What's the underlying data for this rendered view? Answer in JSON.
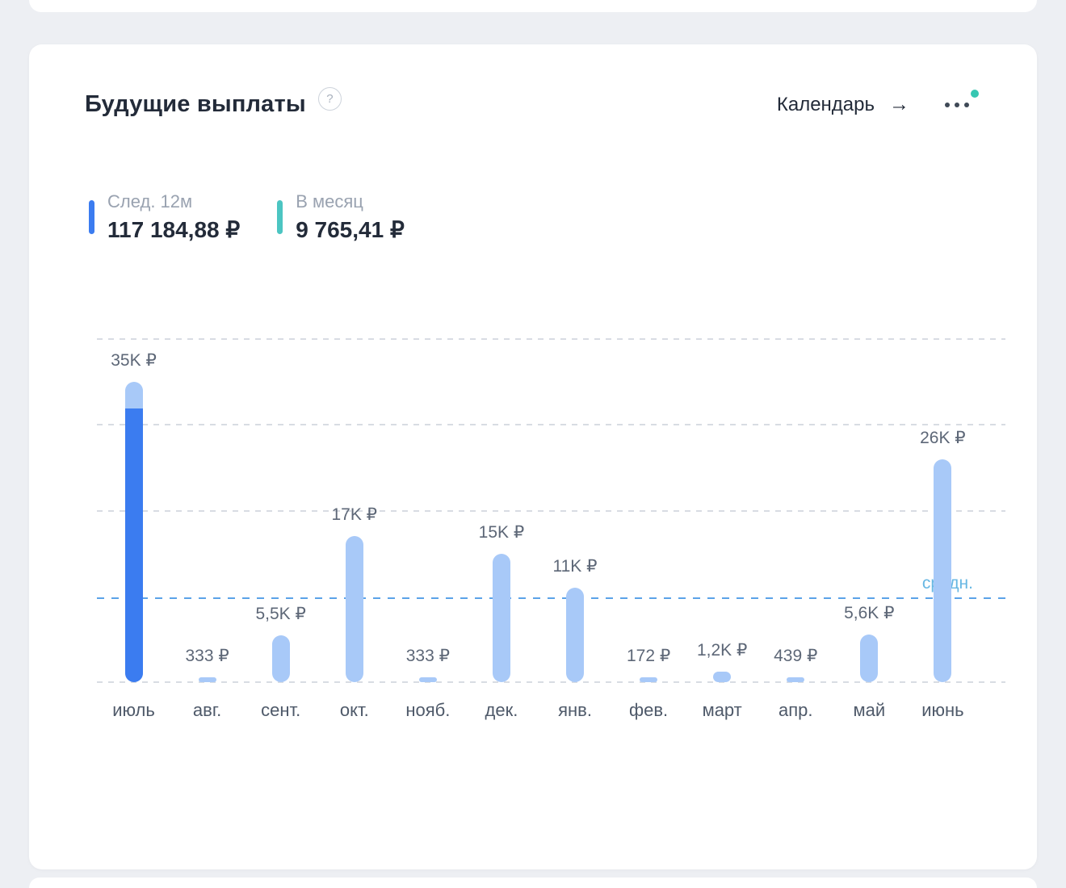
{
  "colors": {
    "background": "#edeff3",
    "card": "#ffffff",
    "title": "#232b39",
    "accent_blue": "#3b7cf0",
    "bar_light": "#a8c9f8",
    "accent_teal": "#4cc5c2",
    "muted_label": "#99a2b0",
    "value_label": "#5d6777",
    "month_label": "#4e5969",
    "grid": "#d8dce3",
    "avg_line": "#5ba3e8",
    "avg_label": "#67b7e3",
    "menu_dot": "#3f4956",
    "notification_dot": "#36c7b2",
    "help_icon": "#a8b0bc"
  },
  "header": {
    "title": "Будущие выплаты",
    "help_icon": "?",
    "calendar_label": "Календарь",
    "arrow_icon": "→"
  },
  "stats": [
    {
      "label": "След. 12м",
      "value": "117 184,88 ₽"
    },
    {
      "label": "В месяц",
      "value": "9 765,41 ₽"
    }
  ],
  "chart_data": {
    "type": "bar",
    "title": "",
    "xlabel": "",
    "ylabel": "",
    "categories": [
      "июль",
      "авг.",
      "сент.",
      "окт.",
      "нояб.",
      "дек.",
      "янв.",
      "фев.",
      "март",
      "апр.",
      "май",
      "июнь"
    ],
    "values": [
      35000,
      333,
      5500,
      17000,
      333,
      15000,
      11000,
      172,
      1200,
      439,
      5600,
      26000
    ],
    "value_labels": [
      "35K ₽",
      "333 ₽",
      "5,5K ₽",
      "17K ₽",
      "333 ₽",
      "15K ₽",
      "11K ₽",
      "172 ₽",
      "1,2K ₽",
      "439 ₽",
      "5,6K ₽",
      "26K ₽"
    ],
    "highlighted_index": 0,
    "highlight_cap_value": 3100,
    "average_value": 9765.41,
    "average_label": "средн.",
    "ylim": [
      0,
      40000
    ],
    "gridline_step": 10000,
    "grid": true,
    "legend_position": "none"
  }
}
